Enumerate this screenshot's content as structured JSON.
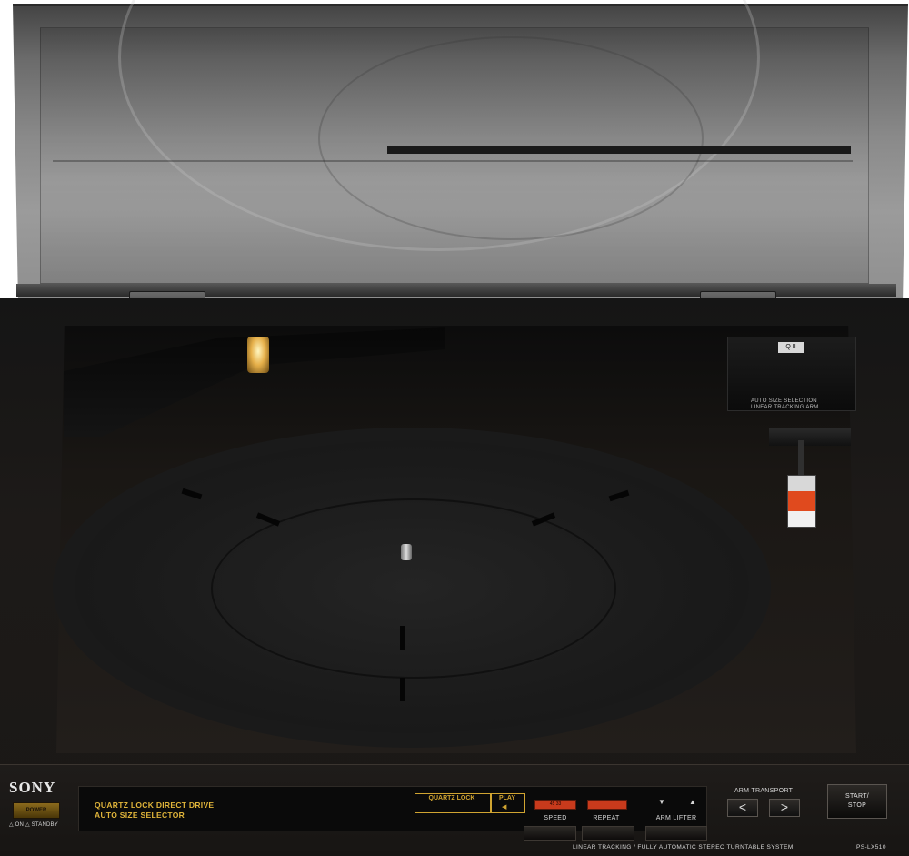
{
  "colors": {
    "accent_gold": "#d0a431",
    "led_red": "#c83a1c",
    "body_black": "#1a1816",
    "brand_white": "#e8e8e8"
  },
  "brand": "SONY",
  "power": {
    "button_label": "POWER",
    "standby_label": "△ ON  △ STANDBY"
  },
  "features": {
    "line1": "QUARTZ LOCK DIRECT DRIVE",
    "line2": "AUTO SIZE SELECTOR"
  },
  "indicators": {
    "quartz_lock": "QUARTZ LOCK",
    "play": "PLAY",
    "speed_led": "45",
    "speed_led_2": "33"
  },
  "buttons": {
    "speed": "SPEED",
    "repeat": "REPEAT",
    "arm_lifter": "ARM LIFTER",
    "arm_transport": "ARM TRANSPORT",
    "arm_left": "<",
    "arm_right": ">",
    "start_stop_line1": "START/",
    "start_stop_line2": "STOP"
  },
  "housing": {
    "badge": "Q II",
    "label_line1": "AUTO SIZE SELECTION",
    "label_line2": "LINEAR TRACKING ARM"
  },
  "system_description": "LINEAR TRACKING / FULLY AUTOMATIC STEREO TURNTABLE SYSTEM",
  "model": "PS-LX510"
}
